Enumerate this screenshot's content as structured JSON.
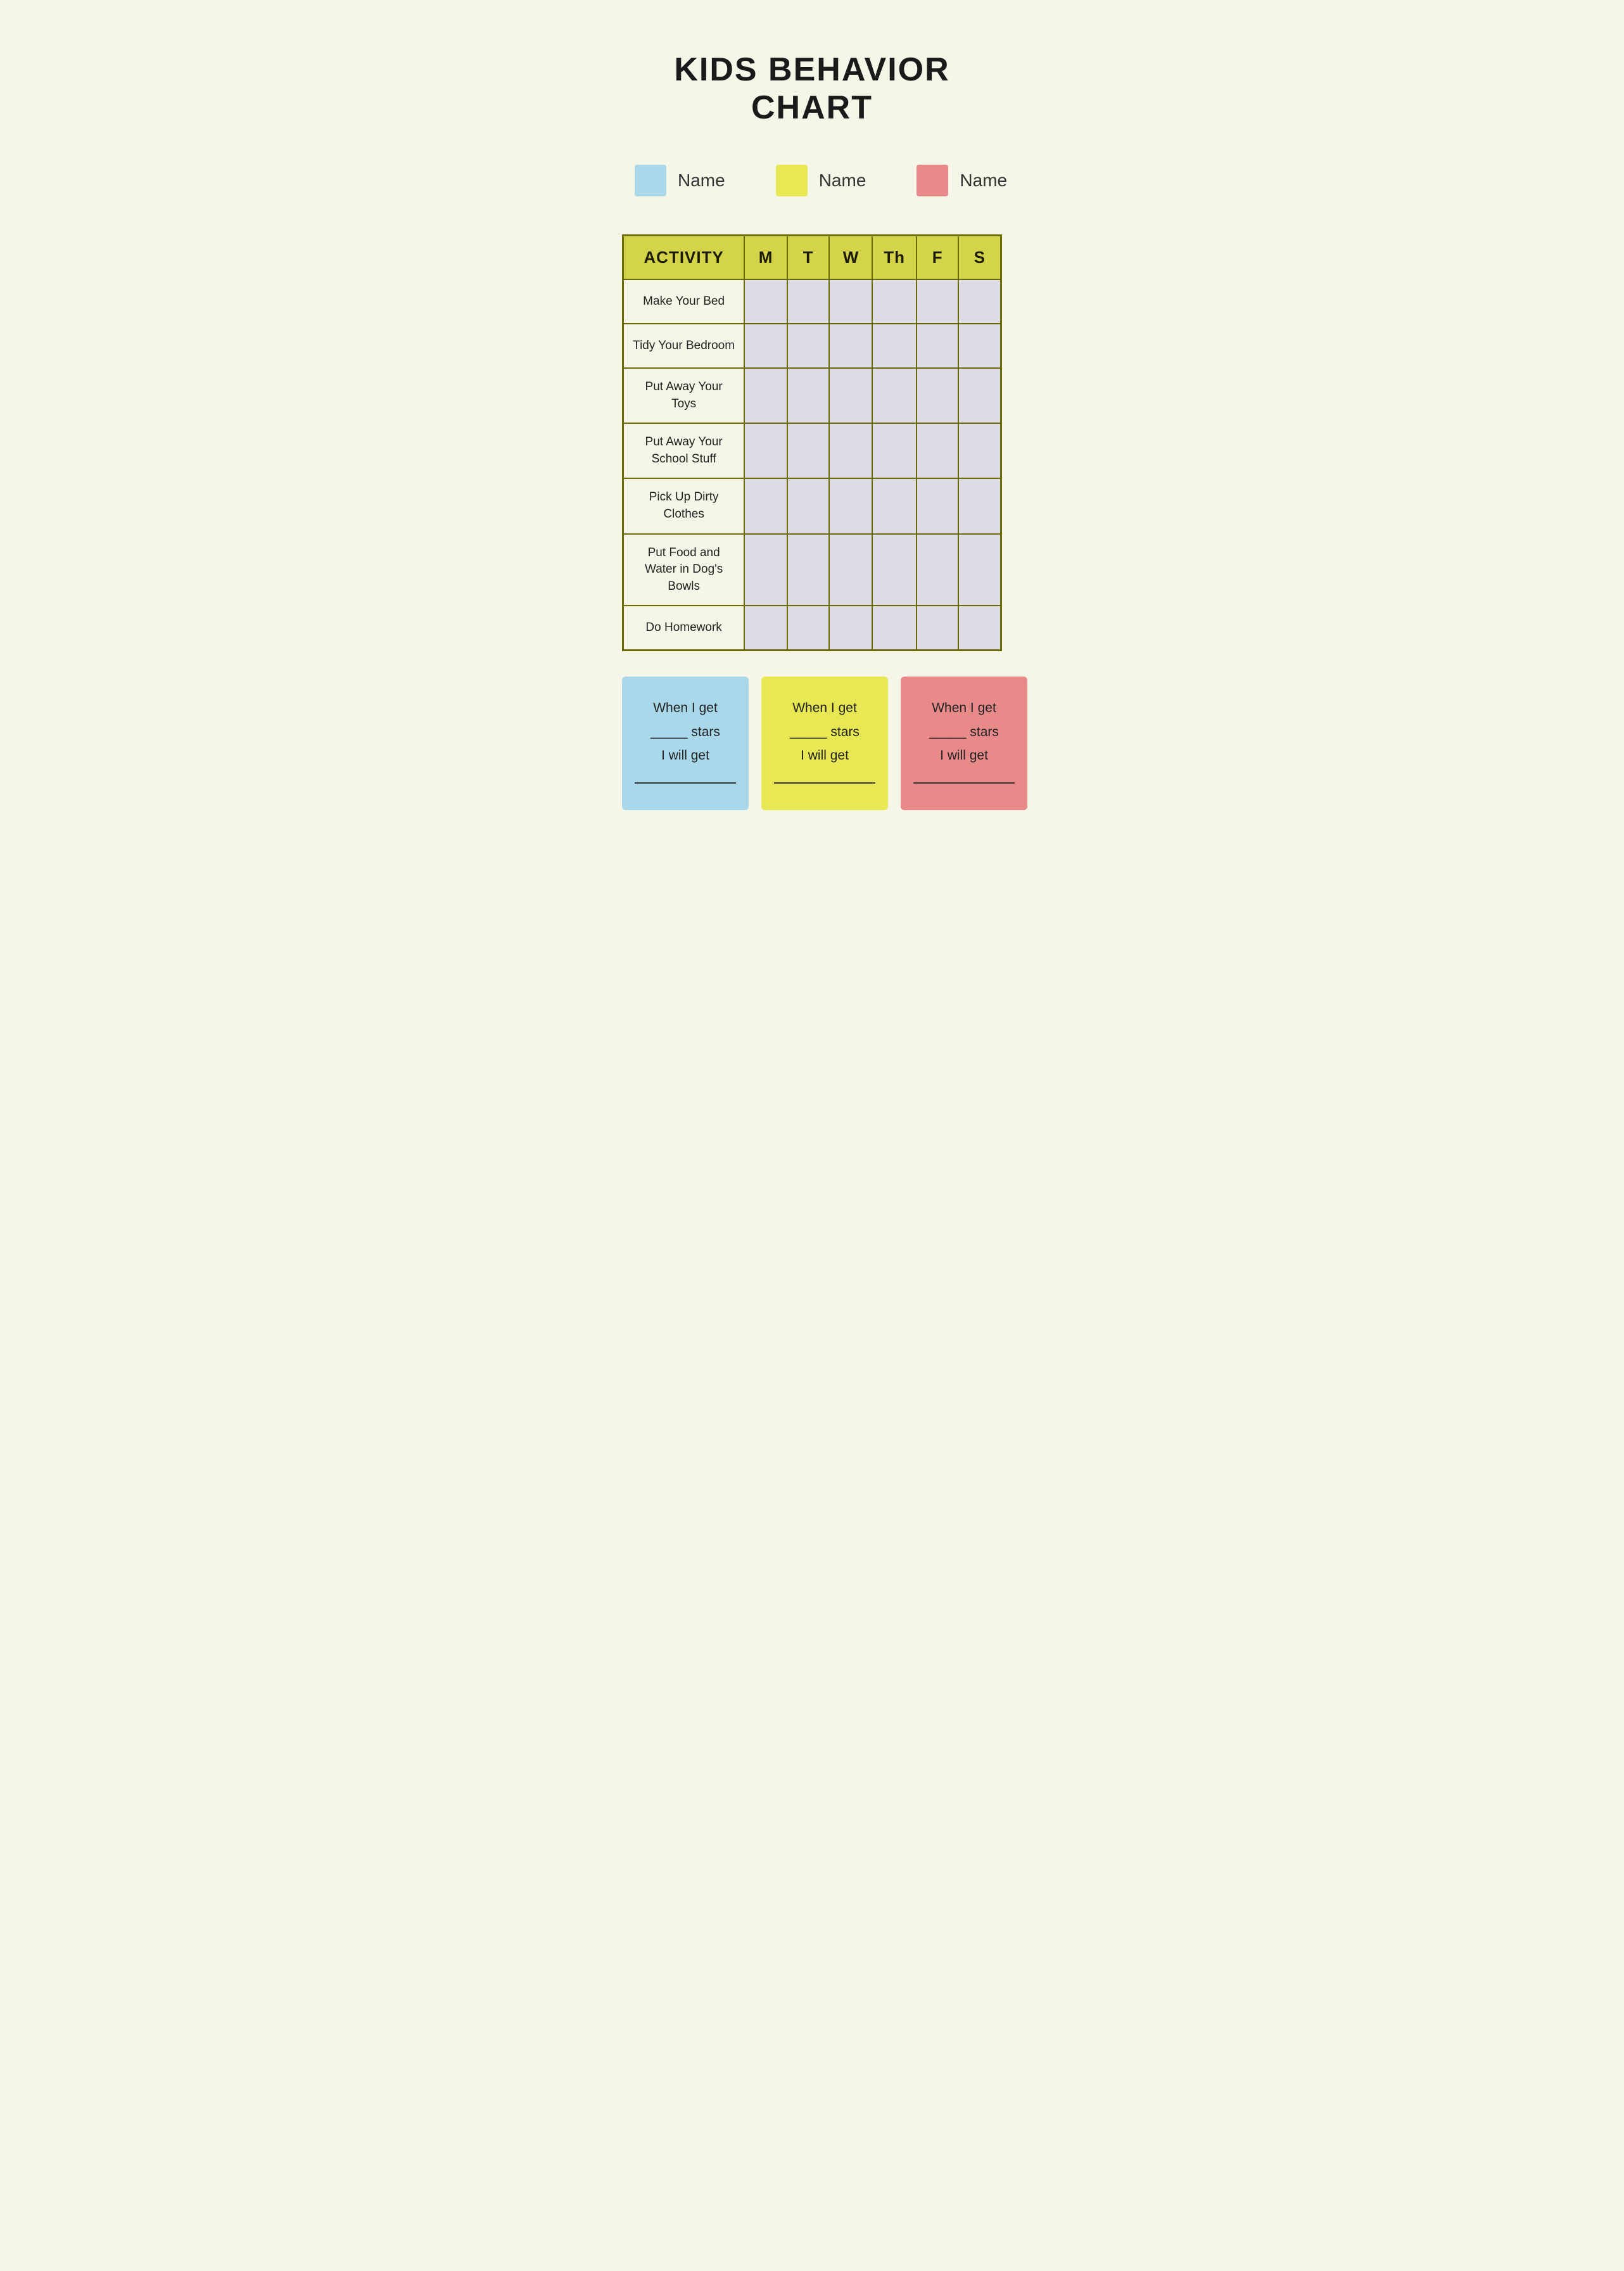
{
  "title": "KIDS BEHAVIOR CHART",
  "legend": [
    {
      "id": "blue",
      "color": "#a8d8ea",
      "name": "Name"
    },
    {
      "id": "yellow",
      "color": "#e8e854",
      "name": "Name"
    },
    {
      "id": "pink",
      "color": "#e88a8a",
      "name": "Name"
    }
  ],
  "table": {
    "headers": [
      "ACTIVITY",
      "M",
      "T",
      "W",
      "Th",
      "F",
      "S"
    ],
    "rows": [
      "Make Your Bed",
      "Tidy Your Bedroom",
      "Put Away Your Toys",
      "Put Away Your School Stuff",
      "Pick Up Dirty Clothes",
      "Put Food and Water in Dog's Bowls",
      "Do Homework"
    ]
  },
  "rewards": [
    {
      "id": "blue",
      "color": "#a8d8ea",
      "line1": "When I get",
      "line2": "_____ stars",
      "line3": "I will get",
      "line4": ""
    },
    {
      "id": "yellow",
      "color": "#e8e854",
      "line1": "When I get",
      "line2": "_____ stars",
      "line3": "I will get",
      "line4": ""
    },
    {
      "id": "pink",
      "color": "#e88a8a",
      "line1": "When I get",
      "line2": "_____ stars",
      "line3": "I will get",
      "line4": ""
    }
  ]
}
